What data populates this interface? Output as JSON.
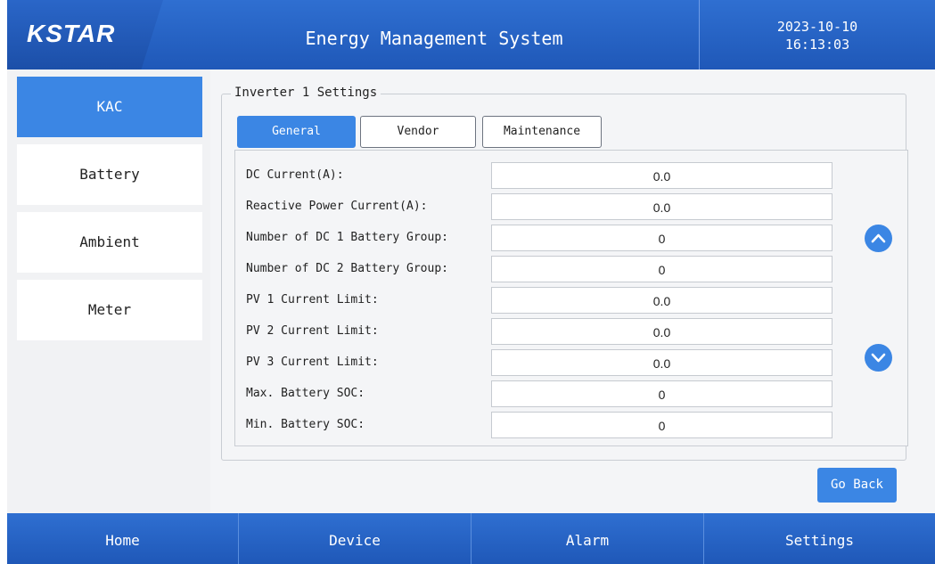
{
  "header": {
    "logo": "KSTAR",
    "title": "Energy Management System",
    "date": "2023-10-10",
    "time": "16:13:03"
  },
  "sidebar": {
    "items": [
      {
        "label": "KAC",
        "active": true
      },
      {
        "label": "Battery",
        "active": false
      },
      {
        "label": "Ambient",
        "active": false
      },
      {
        "label": "Meter",
        "active": false
      }
    ]
  },
  "settings": {
    "section_title": "Inverter 1 Settings",
    "tabs": [
      {
        "label": "General",
        "active": true
      },
      {
        "label": "Vendor",
        "active": false
      },
      {
        "label": "Maintenance",
        "active": false
      }
    ],
    "rows": [
      {
        "label": "DC Current(A):",
        "value": "0.0"
      },
      {
        "label": "Reactive Power Current(A):",
        "value": "0.0"
      },
      {
        "label": "Number of DC 1 Battery Group:",
        "value": "0"
      },
      {
        "label": "Number of DC 2 Battery Group:",
        "value": "0"
      },
      {
        "label": "PV 1 Current Limit:",
        "value": "0.0"
      },
      {
        "label": "PV 2 Current Limit:",
        "value": "0.0"
      },
      {
        "label": "PV 3 Current Limit:",
        "value": "0.0"
      },
      {
        "label": "Max. Battery SOC:",
        "value": "0"
      },
      {
        "label": "Min. Battery SOC:",
        "value": "0"
      }
    ],
    "go_back_label": "Go Back"
  },
  "footer": {
    "items": [
      "Home",
      "Device",
      "Alarm",
      "Settings"
    ]
  },
  "colors": {
    "accent": "#3b86e4",
    "header": "#2f6fd1",
    "background": "#f4f5f7"
  },
  "icons": {
    "scroll_up": "chevron-up-icon",
    "scroll_down": "chevron-down-icon"
  }
}
